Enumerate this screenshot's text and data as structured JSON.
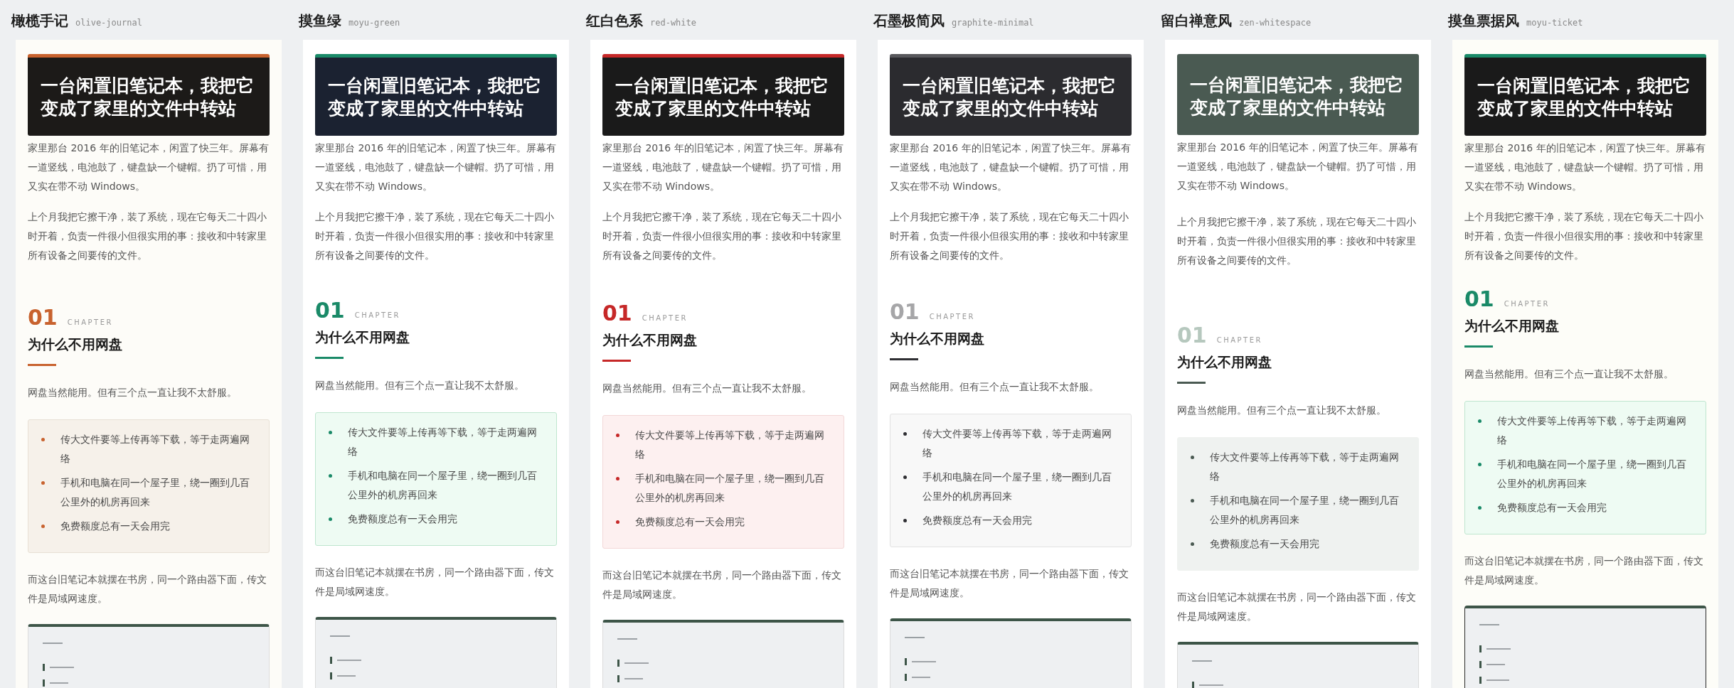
{
  "themes": [
    {
      "name": "橄榄手记",
      "slug": "olive-journal",
      "color": "#c8622e",
      "hero_bar": true,
      "article": {
        "title": "一台闲置旧笔记本，我把它变成了家里的文件中转站",
        "paragraphs": [
          "家里那台 2016 年的旧笔记本，闲置了快三年。屏幕有一道竖线，电池鼓了，键盘缺一个键帽。扔了可惜，用又实在带不动 Windows。",
          "上个月我把它擦干净，装了系统，现在它每天二十四小时开着，负责一件很小但很实用的事：接收和中转家里所有设备之间要传的文件。"
        ],
        "chapter_number": "01",
        "chapter_label": "CHAPTER",
        "heading": "为什么不用网盘",
        "intro": "网盘当然能用。但有三个点一直让我不太舒服。",
        "list": [
          "传大文件要等上传再等下载，等于走两遍网络",
          "手机和电脑在同一个屋子里，绕一圈到几百公里外的机房再回来",
          "免费额度总有一天会用完"
        ],
        "closing": "而这台旧笔记本就摆在书房，同一个路由器下面，传文件是局域网速度。"
      }
    },
    {
      "name": "摸鱼绿",
      "slug": "moyu-green",
      "color": "#1a8a68",
      "hero_bar": true,
      "article": {
        "title": "一台闲置旧笔记本，我把它变成了家里的文件中转站",
        "paragraphs": [
          "家里那台 2016 年的旧笔记本，闲置了快三年。屏幕有一道竖线，电池鼓了，键盘缺一个键帽。扔了可惜，用又实在带不动 Windows。",
          "上个月我把它擦干净，装了系统，现在它每天二十四小时开着，负责一件很小但很实用的事：接收和中转家里所有设备之间要传的文件。"
        ],
        "chapter_number": "01",
        "chapter_label": "CHAPTER",
        "heading": "为什么不用网盘",
        "intro": "网盘当然能用。但有三个点一直让我不太舒服。",
        "list": [
          "传大文件要等上传再等下载，等于走两遍网络",
          "手机和电脑在同一个屋子里，绕一圈到几百公里外的机房再回来",
          "免费额度总有一天会用完"
        ],
        "closing": "而这台旧笔记本就摆在书房，同一个路由器下面，传文件是局域网速度。"
      }
    },
    {
      "name": "红白色系",
      "slug": "red-white",
      "color": "#c62828",
      "hero_bar": true,
      "article": {
        "title": "一台闲置旧笔记本，我把它变成了家里的文件中转站",
        "paragraphs": [
          "家里那台 2016 年的旧笔记本，闲置了快三年。屏幕有一道竖线，电池鼓了，键盘缺一个键帽。扔了可惜，用又实在带不动 Windows。",
          "上个月我把它擦干净，装了系统，现在它每天二十四小时开着，负责一件很小但很实用的事：接收和中转家里所有设备之间要传的文件。"
        ],
        "chapter_number": "01",
        "chapter_label": "CHAPTER",
        "heading": "为什么不用网盘",
        "intro": "网盘当然能用。但有三个点一直让我不太舒服。",
        "list": [
          "传大文件要等上传再等下载，等于走两遍网络",
          "手机和电脑在同一个屋子里，绕一圈到几百公里外的机房再回来",
          "免费额度总有一天会用完"
        ],
        "closing": "而这台旧笔记本就摆在书房，同一个路由器下面，传文件是局域网速度。"
      }
    },
    {
      "name": "石墨极简风",
      "slug": "graphite-minimal",
      "color": "#2e2e32",
      "hero_bar": true,
      "article": {
        "title": "一台闲置旧笔记本，我把它变成了家里的文件中转站",
        "paragraphs": [
          "家里那台 2016 年的旧笔记本，闲置了快三年。屏幕有一道竖线，电池鼓了，键盘缺一个键帽。扔了可惜，用又实在带不动 Windows。",
          "上个月我把它擦干净，装了系统，现在它每天二十四小时开着，负责一件很小但很实用的事：接收和中转家里所有设备之间要传的文件。"
        ],
        "chapter_number": "01",
        "chapter_label": "CHAPTER",
        "heading": "为什么不用网盘",
        "intro": "网盘当然能用。但有三个点一直让我不太舒服。",
        "list": [
          "传大文件要等上传再等下载，等于走两遍网络",
          "手机和电脑在同一个屋子里，绕一圈到几百公里外的机房再回来",
          "免费额度总有一天会用完"
        ],
        "closing": "而这台旧笔记本就摆在书房，同一个路由器下面，传文件是局域网速度。"
      }
    },
    {
      "name": "留白禅意风",
      "slug": "zen-whitespace",
      "color": "#4a5a52",
      "hero_bar": false,
      "article": {
        "title": "一台闲置旧笔记本，我把它变成了家里的文件中转站",
        "paragraphs": [
          "家里那台 2016 年的旧笔记本，闲置了快三年。屏幕有一道竖线，电池鼓了，键盘缺一个键帽。扔了可惜，用又实在带不动 Windows。",
          "上个月我把它擦干净，装了系统，现在它每天二十四小时开着，负责一件很小但很实用的事：接收和中转家里所有设备之间要传的文件。"
        ],
        "chapter_number": "01",
        "chapter_label": "CHAPTER",
        "heading": "为什么不用网盘",
        "intro": "网盘当然能用。但有三个点一直让我不太舒服。",
        "list": [
          "传大文件要等上传再等下载，等于走两遍网络",
          "手机和电脑在同一个屋子里，绕一圈到几百公里外的机房再回来",
          "免费额度总有一天会用完"
        ],
        "closing": "而这台旧笔记本就摆在书房，同一个路由器下面，传文件是局域网速度。"
      }
    },
    {
      "name": "摸鱼票据风",
      "slug": "moyu-ticket",
      "color": "#1a8a68",
      "hero_bar": true,
      "article": {
        "title": "一台闲置旧笔记本，我把它变成了家里的文件中转站",
        "paragraphs": [
          "家里那台 2016 年的旧笔记本，闲置了快三年。屏幕有一道竖线，电池鼓了，键盘缺一个键帽。扔了可惜，用又实在带不动 Windows。",
          "上个月我把它擦干净，装了系统，现在它每天二十四小时开着，负责一件很小但很实用的事：接收和中转家里所有设备之间要传的文件。"
        ],
        "chapter_number": "01",
        "chapter_label": "CHAPTER",
        "heading": "为什么不用网盘",
        "intro": "网盘当然能用。但有三个点一直让我不太舒服。",
        "list": [
          "传大文件要等上传再等下载，等于走两遍网络",
          "手机和电脑在同一个屋子里，绕一圈到几百公里外的机房再回来",
          "免费额度总有一天会用完"
        ],
        "closing": "而这台旧笔记本就摆在书房，同一个路由器下面，传文件是局域网速度。"
      }
    }
  ]
}
